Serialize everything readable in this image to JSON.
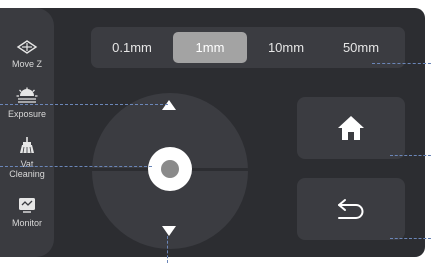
{
  "sidebar": {
    "items": [
      {
        "label": "Move Z",
        "icon": "move-z-icon"
      },
      {
        "label": "Exposure",
        "icon": "exposure-icon"
      },
      {
        "label": "Vat\nCleaning",
        "label_line1": "Vat",
        "label_line2": "Cleaning",
        "icon": "vat-cleaning-icon"
      },
      {
        "label": "Monitor",
        "icon": "monitor-icon"
      }
    ]
  },
  "step_selector": {
    "options": [
      "0.1mm",
      "1mm",
      "10mm",
      "50mm"
    ],
    "selected": "1mm"
  },
  "joystick": {
    "up_icon": "arrow-up-icon",
    "down_icon": "arrow-down-icon"
  },
  "buttons": {
    "home_icon": "home-icon",
    "back_icon": "back-icon"
  },
  "colors": {
    "background": "#2c2d31",
    "surface": "#3b3c41",
    "selected": "#a3a3a3",
    "annotation": "#6b86b8"
  }
}
